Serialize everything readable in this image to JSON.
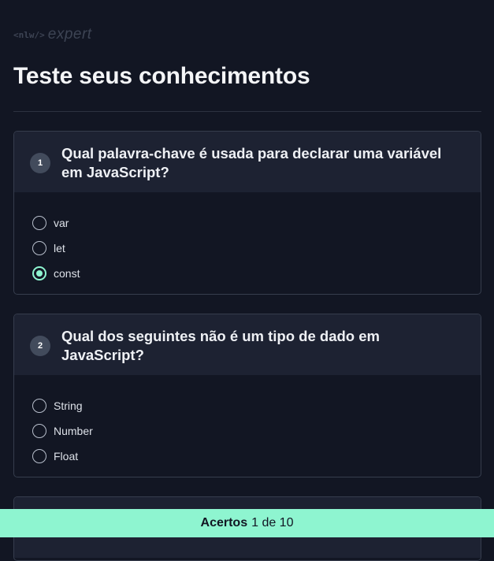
{
  "header": {
    "logo_nlw": "<nlw/>",
    "logo_expert": "expert",
    "title": "Teste seus conhecimentos"
  },
  "questions": [
    {
      "number": "1",
      "text": "Qual palavra-chave é usada para declarar uma variável em JavaScript?",
      "options": [
        "var",
        "let",
        "const"
      ],
      "selected": "const"
    },
    {
      "number": "2",
      "text": "Qual dos seguintes não é um tipo de dado em JavaScript?",
      "options": [
        "String",
        "Number",
        "Float"
      ],
      "selected": null
    }
  ],
  "footer": {
    "label": "Acertos",
    "score": "1 de 10"
  },
  "colors": {
    "background": "#121623",
    "card_header": "#1d2232",
    "accent": "#8ef5d0"
  }
}
